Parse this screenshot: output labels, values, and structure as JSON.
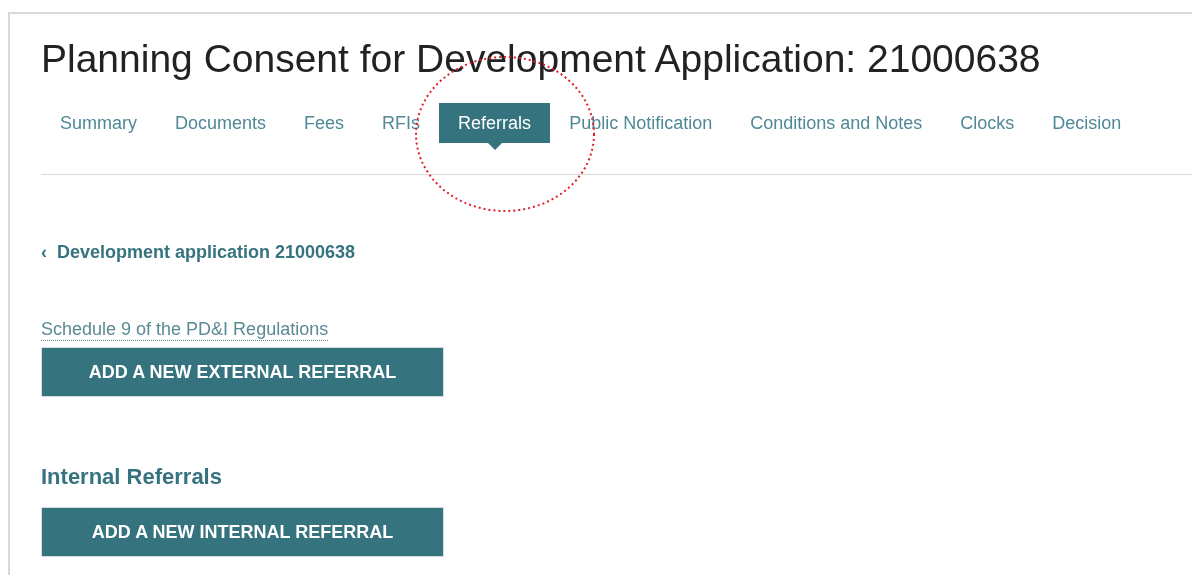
{
  "page_title": "Planning Consent for Development Application: 21000638",
  "tabs": [
    {
      "label": "Summary",
      "selected": false
    },
    {
      "label": "Documents",
      "selected": false
    },
    {
      "label": "Fees",
      "selected": false
    },
    {
      "label": "RFIs",
      "selected": false
    },
    {
      "label": "Referrals",
      "selected": true
    },
    {
      "label": "Public Notification",
      "selected": false
    },
    {
      "label": "Conditions and Notes",
      "selected": false
    },
    {
      "label": "Clocks",
      "selected": false
    },
    {
      "label": "Decision",
      "selected": false
    }
  ],
  "back_link": {
    "icon": "‹",
    "label": "Development application 21000638"
  },
  "schedule_link": "Schedule 9 of the PD&I Regulations",
  "external_button": "ADD A NEW EXTERNAL REFERRAL",
  "internal_heading": "Internal Referrals",
  "internal_button": "ADD A NEW INTERNAL REFERRAL"
}
